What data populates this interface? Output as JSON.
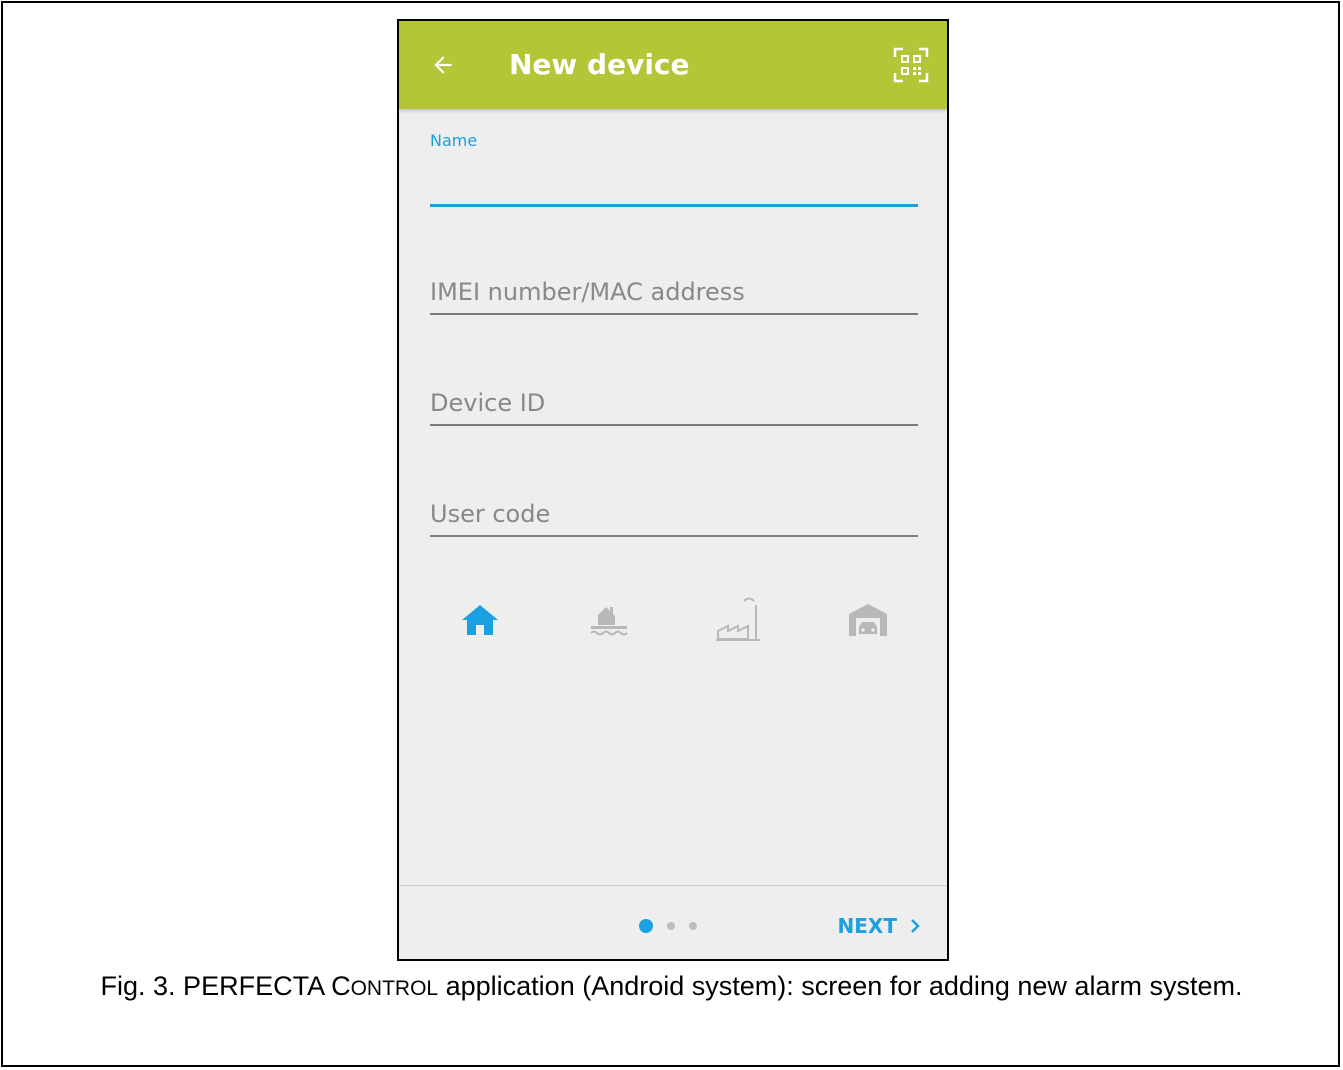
{
  "app_bar": {
    "title": "New device",
    "background_color": "#b4c637",
    "back_icon": "arrow-left-icon",
    "qr_icon": "qr-code-scan-icon"
  },
  "form": {
    "name_label": "Name",
    "name_value": "",
    "imei_placeholder": "IMEI number/MAC address",
    "device_id_placeholder": "Device ID",
    "user_code_placeholder": "User code",
    "accent_color": "#1ba0e2"
  },
  "device_types": [
    {
      "icon": "home-icon",
      "selected": true
    },
    {
      "icon": "lake-house-icon",
      "selected": false
    },
    {
      "icon": "factory-icon",
      "selected": false
    },
    {
      "icon": "garage-icon",
      "selected": false
    }
  ],
  "footer": {
    "pages": 3,
    "current_page": 1,
    "next_label": "NEXT",
    "next_icon": "chevron-right-icon"
  },
  "caption": {
    "prefix": "Fig. 3. PERFECTA C",
    "small_caps_1": "ONTROL",
    "suffix": " application (Android system): screen for adding new alarm system."
  }
}
